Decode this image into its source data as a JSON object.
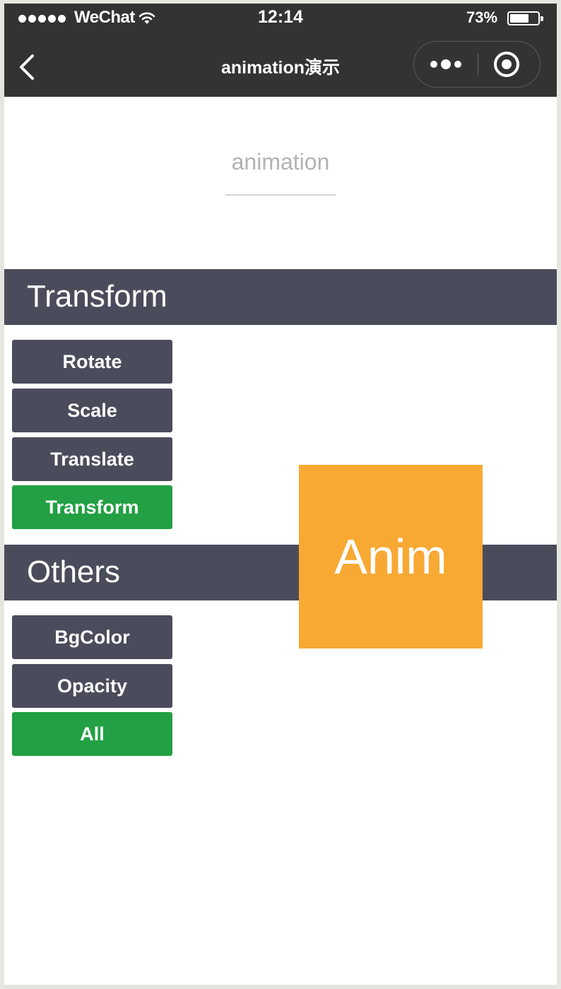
{
  "status_bar": {
    "carrier": "WeChat",
    "time": "12:14",
    "battery_percent": "73%",
    "battery_level": 0.73
  },
  "nav": {
    "back_icon": "chevron-left-icon",
    "title": "animation演示",
    "more_icon": "more-dots-icon",
    "close_icon": "target-circle-icon"
  },
  "page": {
    "heading": "animation"
  },
  "sections": {
    "transform": "Transform",
    "others": "Others"
  },
  "buttons": {
    "rotate": "Rotate",
    "scale": "Scale",
    "translate": "Translate",
    "transform": "Transform",
    "bgcolor": "BgColor",
    "opacity": "Opacity",
    "all": "All"
  },
  "animation_box": {
    "label": "Anim"
  },
  "colors": {
    "nav_background": "#333333",
    "section_background": "#4b4c5b",
    "button_default": "#4b4c5b",
    "button_primary": "#22a043",
    "animation_box": "#f8a933"
  }
}
